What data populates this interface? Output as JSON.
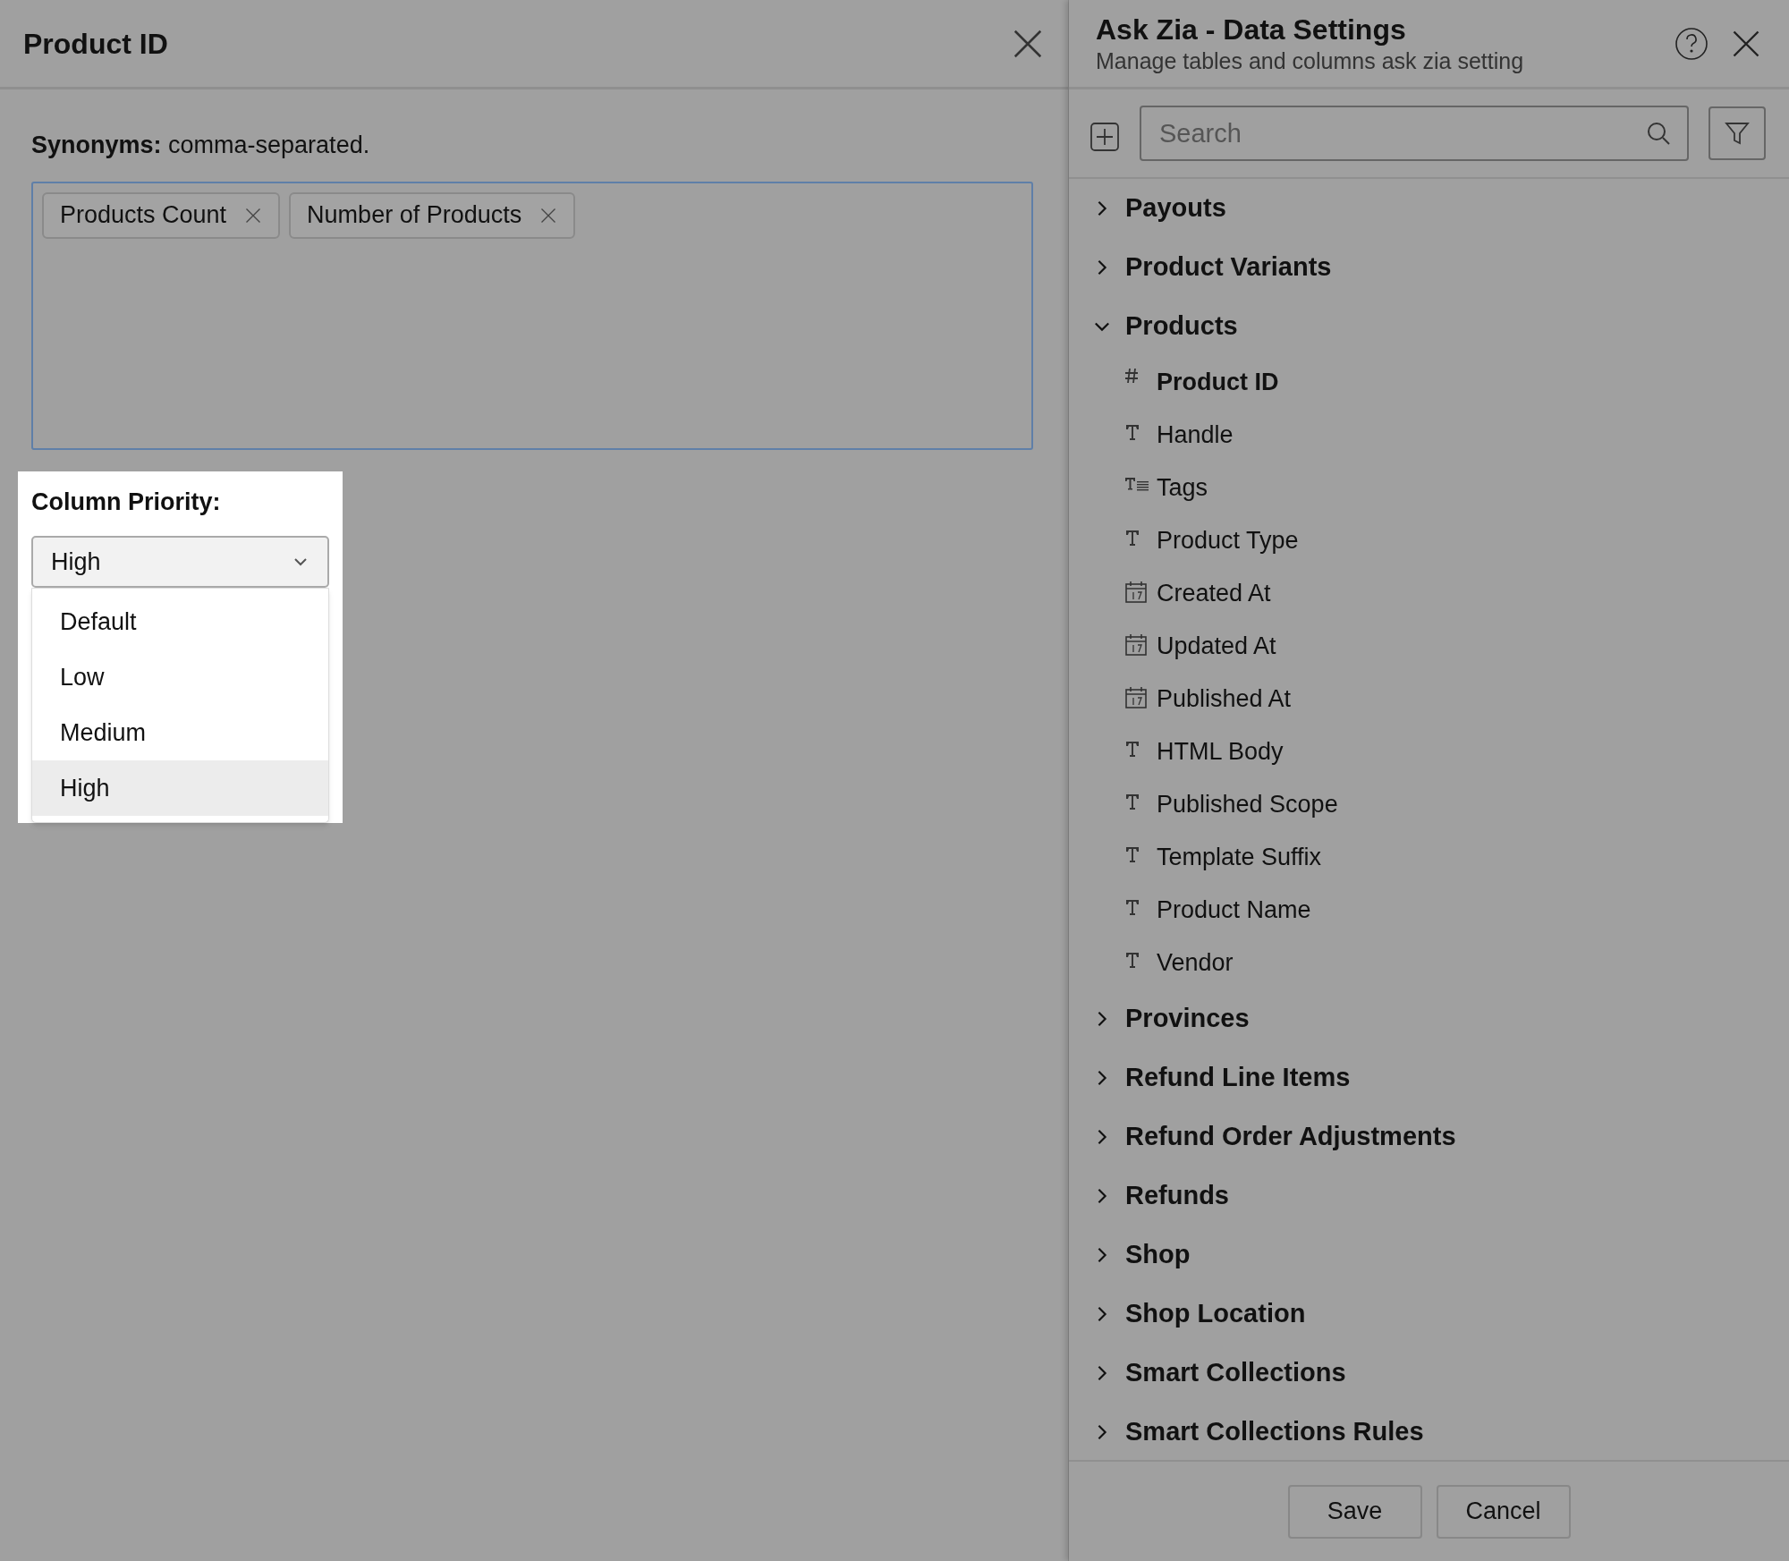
{
  "detail_panel": {
    "title": "Product ID",
    "synonyms_label": "Synonyms:",
    "synonyms_hint": "comma-separated.",
    "synonyms": [
      "Products Count",
      "Number of Products"
    ],
    "priority_label": "Column Priority:",
    "priority_value": "High",
    "priority_options": [
      {
        "label": "Default",
        "selected": false
      },
      {
        "label": "Low",
        "selected": false
      },
      {
        "label": "Medium",
        "selected": false
      },
      {
        "label": "High",
        "selected": true
      }
    ]
  },
  "settings_panel": {
    "title": "Ask Zia - Data Settings",
    "subtitle": "Manage tables and columns ask zia setting",
    "search": {
      "placeholder": "Search"
    },
    "tables": [
      {
        "name": "Payouts",
        "expanded": false
      },
      {
        "name": "Product Variants",
        "expanded": false
      },
      {
        "name": "Products",
        "expanded": true,
        "children": [
          {
            "name": "Product ID",
            "kind": "number",
            "selected": true
          },
          {
            "name": "Handle",
            "kind": "text",
            "selected": false
          },
          {
            "name": "Tags",
            "kind": "textlist",
            "selected": false
          },
          {
            "name": "Product Type",
            "kind": "text",
            "selected": false
          },
          {
            "name": "Created At",
            "kind": "date",
            "selected": false
          },
          {
            "name": "Updated At",
            "kind": "date",
            "selected": false
          },
          {
            "name": "Published At",
            "kind": "date",
            "selected": false
          },
          {
            "name": "HTML Body",
            "kind": "text",
            "selected": false
          },
          {
            "name": "Published Scope",
            "kind": "text",
            "selected": false
          },
          {
            "name": "Template Suffix",
            "kind": "text",
            "selected": false
          },
          {
            "name": "Product Name",
            "kind": "text",
            "selected": false
          },
          {
            "name": "Vendor",
            "kind": "text",
            "selected": false
          }
        ]
      },
      {
        "name": "Provinces",
        "expanded": false
      },
      {
        "name": "Refund Line Items",
        "expanded": false
      },
      {
        "name": "Refund Order Adjustments",
        "expanded": false
      },
      {
        "name": "Refunds",
        "expanded": false
      },
      {
        "name": "Shop",
        "expanded": false
      },
      {
        "name": "Shop Location",
        "expanded": false
      },
      {
        "name": "Smart Collections",
        "expanded": false
      },
      {
        "name": "Smart Collections Rules",
        "expanded": false
      }
    ],
    "buttons": [
      "Save",
      "Cancel"
    ]
  }
}
